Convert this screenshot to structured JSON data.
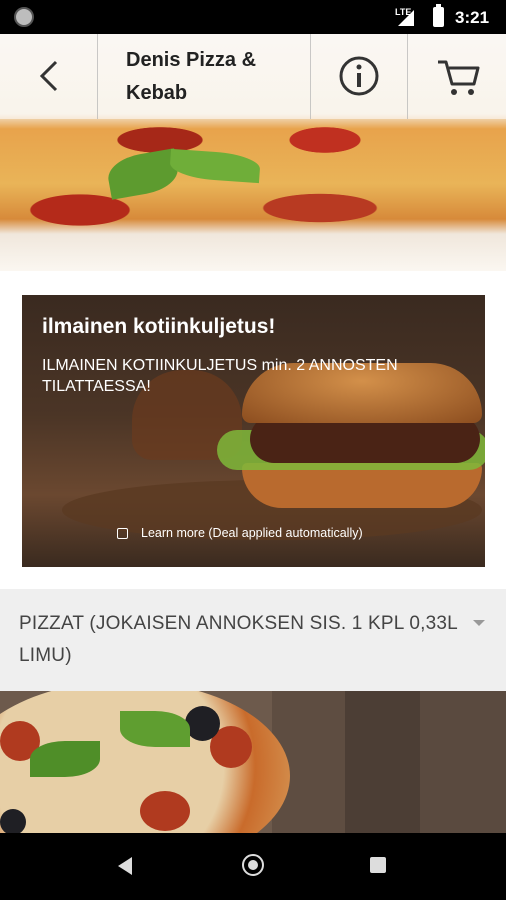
{
  "status_bar": {
    "network": "LTE",
    "time": "3:21"
  },
  "header": {
    "title": "Denis Pizza & Kebab",
    "icons": {
      "back": "back-arrow-icon",
      "info": "info-icon",
      "cart": "cart-icon"
    }
  },
  "promo": {
    "title": "ilmainen kotiinkuljetus!",
    "text": "ILMAINEN KOTIINKULJETUS min. 2 ANNOSTEN TILATTAESSA!",
    "learn_more": "Learn more (Deal applied automatically)"
  },
  "category": {
    "label": "PIZZAT (JOKAISEN ANNOKSEN SIS. 1 KPL 0,33L LIMU)"
  },
  "nav": {
    "icons": [
      "nav-back-icon",
      "nav-home-icon",
      "nav-recents-icon"
    ]
  }
}
